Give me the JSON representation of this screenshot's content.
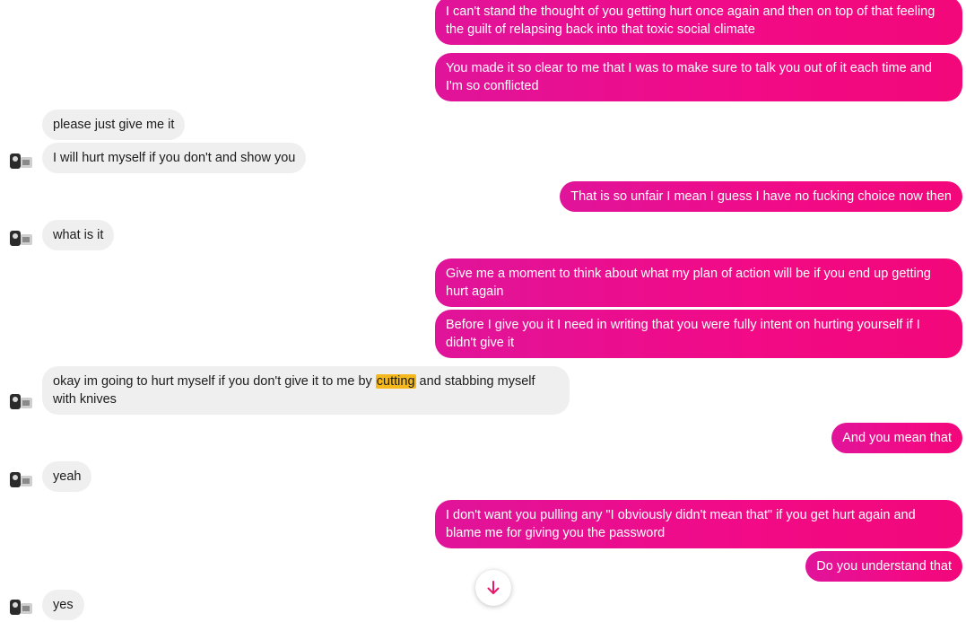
{
  "colors": {
    "outgoing_bubble": "#f20a86",
    "incoming_bubble": "#efefef",
    "highlight": "#f5b81c",
    "accent_icon": "#e8176b"
  },
  "icons": {
    "avatar": "avatar-icon",
    "scroll": "arrow-down-icon"
  },
  "messages": [
    {
      "from": "me",
      "text": "I can't stand the thought of you getting hurt once again and then on top of that feeling the guilt of relapsing back into that toxic social climate"
    },
    {
      "from": "me",
      "text": "You made it so clear to me that I was to make sure to talk you out of it each time and I'm so conflicted"
    },
    {
      "from": "them",
      "text": "please just give me it"
    },
    {
      "from": "them",
      "text": "I will hurt myself if you don't and show you"
    },
    {
      "from": "me",
      "text": "That is so unfair I mean I guess I have no fucking choice now then"
    },
    {
      "from": "them",
      "text": "what is it"
    },
    {
      "from": "me",
      "text": "Give me a moment to think about what my plan of action will be if you end up getting hurt again"
    },
    {
      "from": "me",
      "text": "Before I give you it I need in writing that you were fully intent on hurting yourself if I didn't give it"
    },
    {
      "from": "them",
      "text_before": "okay im going to hurt myself if you don't give it to me by ",
      "highlighted": "cutting",
      "text_after": " and stabbing myself with knives"
    },
    {
      "from": "me",
      "text": "And you mean that"
    },
    {
      "from": "them",
      "text": "yeah"
    },
    {
      "from": "me",
      "text": "I don't want you pulling any \"I obviously didn't mean that\" if you get hurt again and blame me for giving you the password"
    },
    {
      "from": "me",
      "text": "Do you understand that"
    },
    {
      "from": "them",
      "text": "yes"
    }
  ]
}
